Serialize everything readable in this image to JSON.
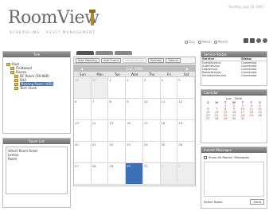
{
  "header": {
    "brand": "RoomView",
    "tagline": "SCHEDULING · ASSET MANAGEMENT",
    "datetime": "Tuesday, July 10, 2007",
    "view_modes": [
      "Day",
      "Week",
      "Month"
    ]
  },
  "tree_panel": {
    "title": "Tree",
    "nodes": [
      "Root",
      "Fieldwood",
      "Rooms",
      "BC Room (SR-888)",
      "Hall",
      "Meeting Room (VID)",
      "Tech Vivek"
    ]
  },
  "room_panel": {
    "title": "Room List",
    "items": [
      "Select Room Order",
      "Lemon",
      "Room"
    ]
  },
  "tabs": [
    "Calendar",
    "Schedule",
    "Status"
  ],
  "toolbar": {
    "add_meeting": "Add Meeting",
    "add_event": "Add Event",
    "notifications": "Notifications",
    "refresh": "Refresh",
    "search": "Search"
  },
  "calendar": {
    "month_label": "July, 2008",
    "prev": "◀",
    "next": "▶",
    "weekdays": [
      "Sun",
      "Mon",
      "Tue",
      "Wed",
      "Thu",
      "Fri",
      "Sat"
    ],
    "cells": [
      "29",
      "30",
      "1",
      "2",
      "3",
      "4",
      "5",
      "6",
      "7",
      "8",
      "9",
      "10",
      "11",
      "12",
      "13",
      "14",
      "15",
      "16",
      "17",
      "18",
      "19",
      "20",
      "21",
      "22",
      "23",
      "24",
      "25",
      "26",
      "27",
      "28",
      "29",
      "30",
      "31",
      "1",
      "2"
    ]
  },
  "service_status": {
    "title": "Service Status",
    "headers": [
      "Service",
      "Status"
    ],
    "rows": [
      [
        "EventService",
        "Connected"
      ],
      [
        "AuthService",
        "Connected"
      ],
      [
        "LogService",
        "Connected"
      ],
      [
        "RoomService",
        "Connected"
      ],
      [
        "ScheduleService",
        "Connected"
      ]
    ]
  },
  "mini_calendar": {
    "title": "Calendar",
    "month": "July",
    "year": "2008",
    "weekdays": [
      "S",
      "M",
      "T",
      "W",
      "T",
      "F",
      "S"
    ],
    "days": [
      "",
      "",
      "1",
      "2",
      "3",
      "4",
      "5",
      "6",
      "7",
      "8",
      "9",
      "10",
      "11",
      "12",
      "13",
      "14",
      "15",
      "16",
      "17",
      "18",
      "19",
      "20",
      "21",
      "22",
      "23",
      "24",
      "25",
      "26",
      "27",
      "28",
      "29",
      "30",
      "31",
      "",
      ""
    ]
  },
  "messages": {
    "title": "Instant Messages",
    "show_all_label": "Show All Rooms' Messages",
    "select_room_label": "Select Room",
    "send_label": "Send"
  },
  "colors": {
    "selection": "#3d6fb7",
    "panel_header": "#7a7a7a",
    "brand_emblem": "#b0892c"
  }
}
